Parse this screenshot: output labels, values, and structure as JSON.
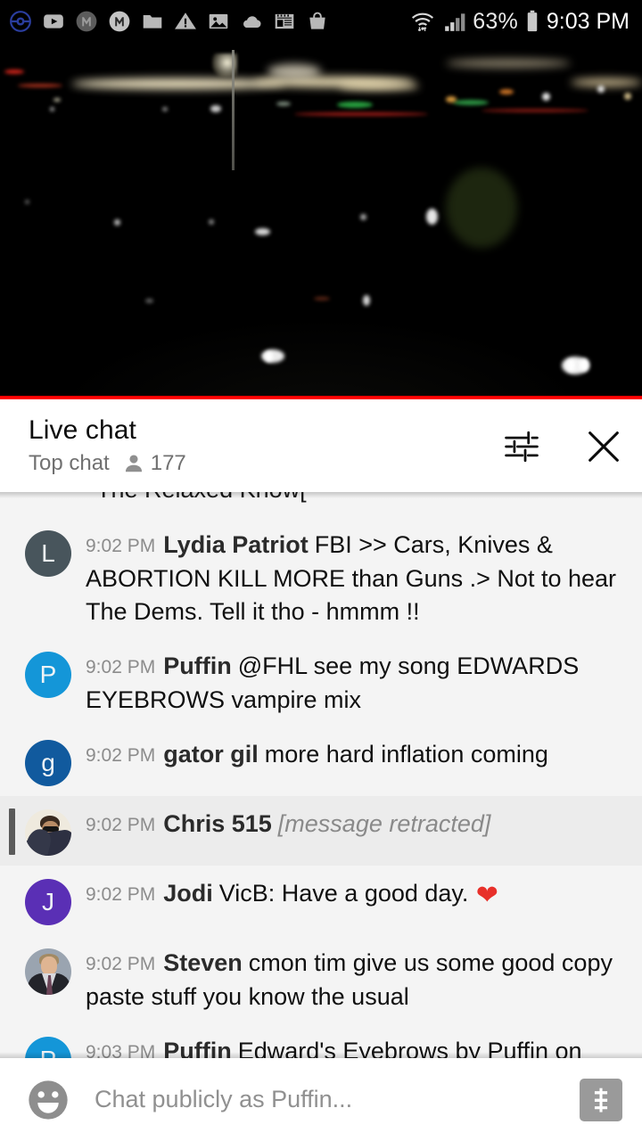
{
  "statusbar": {
    "icons": [
      {
        "name": "pokemon-go-icon"
      },
      {
        "name": "youtube-icon"
      },
      {
        "name": "messenger-dark-icon"
      },
      {
        "name": "messenger-light-icon"
      },
      {
        "name": "folder-icon"
      },
      {
        "name": "warning-triangle-icon"
      },
      {
        "name": "photo-icon"
      },
      {
        "name": "cloud-icon"
      },
      {
        "name": "news-icon"
      },
      {
        "name": "shopping-bag-icon"
      }
    ],
    "wifi_icon": "wifi-icon",
    "signal_icon": "cell-signal-icon",
    "battery_percent": "63%",
    "battery_icon": "battery-icon",
    "clock": "9:03 PM"
  },
  "video": {
    "name": "live-stream-night-cityscape",
    "progress_color": "#ff0000",
    "progress_percent": 100
  },
  "chat_header": {
    "title": "Live chat",
    "mode": "Top chat",
    "viewer_icon": "person-icon",
    "viewer_count": "177",
    "settings_icon": "chat-settings-sliders-icon",
    "close_icon": "close-icon"
  },
  "partial_message": {
    "text": "The Relaxed Know["
  },
  "messages": [
    {
      "timestamp": "9:02 PM",
      "author": "Lydia Patriot",
      "text": "FBI >> Cars, Knives & ABORTION KILL MORE than Guns .> Not to hear The Dems. Tell it tho - hmmm !!",
      "avatar_type": "initial",
      "avatar_initial": "L",
      "avatar_color": "#48555c",
      "retracted": false,
      "highlighted": false
    },
    {
      "timestamp": "9:02 PM",
      "author": "Puffin",
      "text": "@FHL see my song EDWARDS EYEBROWS vampire mix",
      "avatar_type": "initial",
      "avatar_initial": "P",
      "avatar_color": "#1496d8",
      "retracted": false,
      "highlighted": false
    },
    {
      "timestamp": "9:02 PM",
      "author": "gator gil",
      "text": "more hard inflation coming",
      "avatar_type": "initial",
      "avatar_initial": "g",
      "avatar_color": "#115a9e",
      "retracted": false,
      "highlighted": false
    },
    {
      "timestamp": "9:02 PM",
      "author": "Chris 515",
      "text": "[message retracted]",
      "avatar_type": "photo-chris",
      "avatar_initial": "",
      "avatar_color": "#efeade",
      "retracted": true,
      "highlighted": true
    },
    {
      "timestamp": "9:02 PM",
      "author": "Jodi",
      "text": "VicB: Have a good day.",
      "emoji": "❤",
      "avatar_type": "initial",
      "avatar_initial": "J",
      "avatar_color": "#5a2fb5",
      "retracted": false,
      "highlighted": false
    },
    {
      "timestamp": "9:02 PM",
      "author": "Steven",
      "text": "cmon tim give us some good copy paste stuff you know the usual",
      "avatar_type": "photo-steven",
      "avatar_initial": "",
      "avatar_color": "#9aa4b0",
      "retracted": false,
      "highlighted": false
    },
    {
      "timestamp": "9:03 PM",
      "author": "Puffin",
      "text": "Edward's Eyebrows by Puffin on YouTube",
      "avatar_type": "initial",
      "avatar_initial": "P",
      "avatar_color": "#1496d8",
      "retracted": false,
      "highlighted": false
    }
  ],
  "input_bar": {
    "emoji_icon": "emoji-smiley-icon",
    "placeholder": "Chat publicly as Puffin...",
    "value": "",
    "superchat_icon": "super-chat-dollar-icon"
  }
}
